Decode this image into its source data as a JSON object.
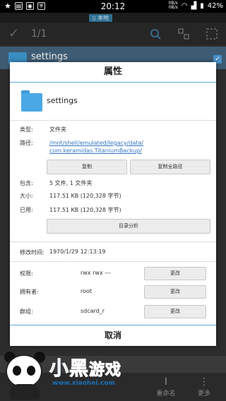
{
  "status_bar": {
    "time": "20:12",
    "speed_up": "0B/s",
    "speed_down": "0B/s",
    "battery": "42%"
  },
  "location_tab": "本地",
  "toolbar": {
    "selection_count": "1/1"
  },
  "list": {
    "items": [
      {
        "name": "settings",
        "checked": true
      }
    ]
  },
  "dialog": {
    "title": "属性",
    "file_name": "settings",
    "type_label": "类型:",
    "type_value": "文件夹",
    "path_label": "路径:",
    "path_line1": "/mnt/shell/emulated/legacy/data/",
    "path_line2": "com.keramidas.TitaniumBackup/",
    "copy_button": "复制",
    "copy_full_path_button": "复制全路径",
    "contains_label": "包含:",
    "contains_value": "5 文件, 1 文件夹",
    "size_label": "大小:",
    "size_value": "117.51 KB (120,328 字节)",
    "used_label": "已用:",
    "used_value": "117.51 KB (120,328 字节)",
    "analyze_button": "目录分析",
    "modified_label": "修改时间:",
    "modified_value": "1970/1/29 12:13:19",
    "permission_label": "权限:",
    "permission_value": "rwx rwx ---",
    "owner_label": "拥有者:",
    "owner_value": "root",
    "group_label": "群组:",
    "group_value": "sdcard_r",
    "change_button": "更改",
    "cancel_button": "取消"
  },
  "bottom_bar": {
    "rename_label": "重命名",
    "more_label": "更多"
  },
  "watermark": {
    "title_main": "小黑",
    "title_sub": "游戏",
    "url": "www.xiaohei.com"
  },
  "colors": {
    "accent": "#5aaad8",
    "link": "#3577c2",
    "folder": "#4aa8e4"
  }
}
